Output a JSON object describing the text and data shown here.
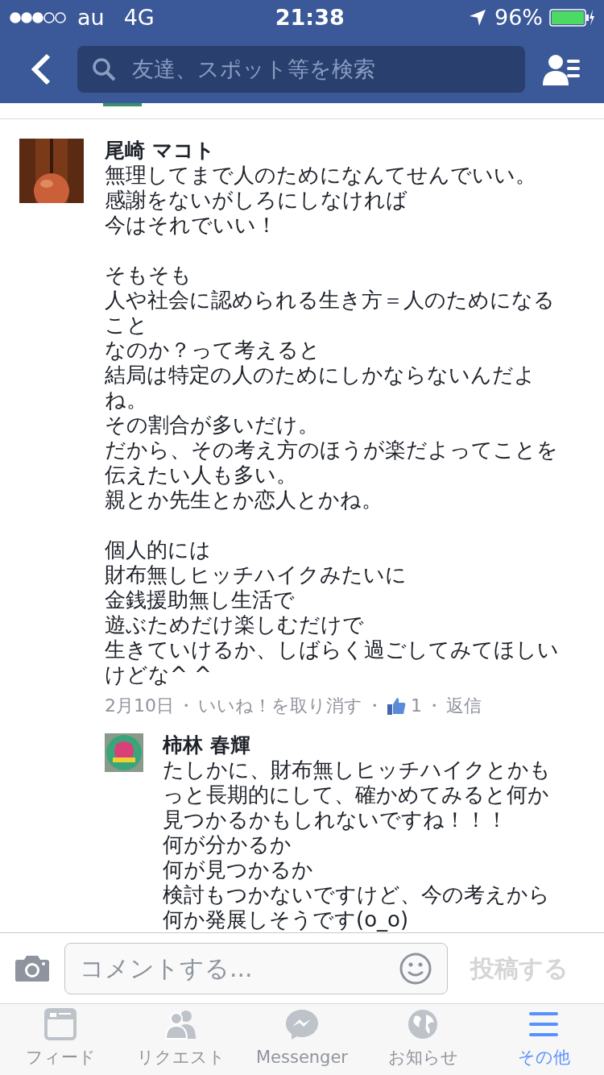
{
  "status_bar": {
    "carrier": "au",
    "network": "4G",
    "time": "21:38",
    "battery": "96%"
  },
  "search": {
    "placeholder": "友達、スポット等を検索"
  },
  "comment": {
    "author": "尾崎 マコト",
    "paragraphs": [
      [
        "無理してまで人のためになんてせんでいい。",
        "感謝をないがしろにしなければ",
        "今はそれでいい！"
      ],
      [
        "そもそも",
        "人や社会に認められる生き方＝人のためになる",
        "こと",
        "なのか？って考えると",
        "結局は特定の人のためにしかならないんだよ",
        "ね。",
        "その割合が多いだけ。",
        "だから、その考え方のほうが楽だよってことを",
        "伝えたい人も多い。",
        "親とか先生とか恋人とかね。"
      ],
      [
        "個人的には",
        "財布無しヒッチハイクみたいに",
        "金銭援助無し生活で",
        "遊ぶためだけ楽しむだけで",
        "生きていけるか、しばらく過ごしてみてほしい",
        "けどな^ ^"
      ]
    ],
    "date": "2月10日",
    "separator": "・",
    "unlike": "いいね！を取り消す",
    "likes": "1",
    "reply": "返信"
  },
  "reply": {
    "author": "柿林 春輝",
    "lines": [
      "たしかに、財布無しヒッチハイクとかも",
      "っと長期的にして、確かめてみると何か",
      "見つかるかもしれないですね！！！",
      "何が分かるか",
      "何が見つかるか",
      "検討もつかないですけど、今の考えから",
      "何か発展しそうです(o_o)"
    ]
  },
  "composer": {
    "placeholder": "コメントする...",
    "post": "投稿する"
  },
  "tabs": [
    {
      "kind": "feed",
      "label": "フィード",
      "selected": false
    },
    {
      "kind": "requests",
      "label": "リクエスト",
      "selected": false
    },
    {
      "kind": "messenger",
      "label": "Messenger",
      "selected": false
    },
    {
      "kind": "notifications",
      "label": "お知らせ",
      "selected": false
    },
    {
      "kind": "more",
      "label": "その他",
      "selected": true
    }
  ]
}
